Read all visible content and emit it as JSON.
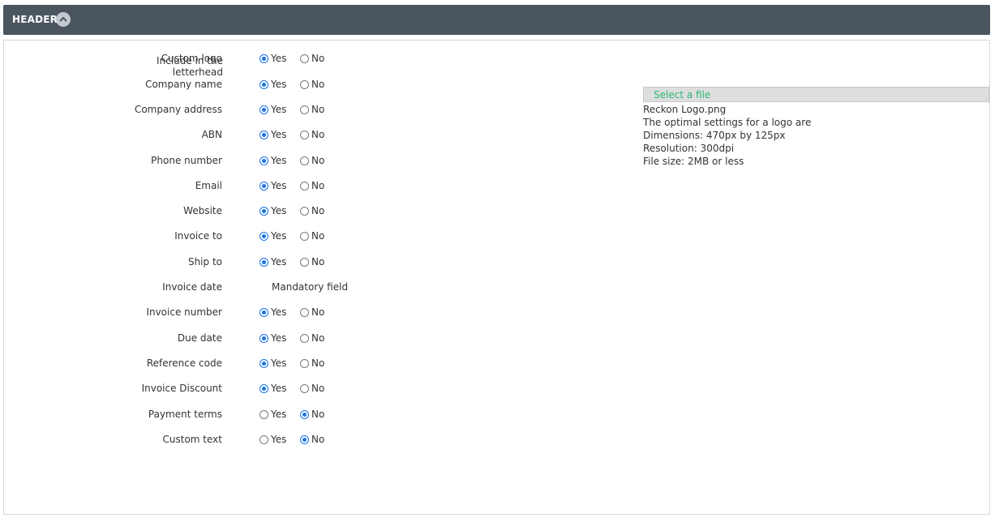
{
  "header": {
    "title": "HEADER"
  },
  "section": {
    "label": "Include in the letterhead"
  },
  "options": {
    "yes": "Yes",
    "no": "No"
  },
  "rows": [
    {
      "label": "Custom logo",
      "value": "Yes"
    },
    {
      "label": "Company name",
      "value": "Yes"
    },
    {
      "label": "Company address",
      "value": "Yes"
    },
    {
      "label": "ABN",
      "value": "Yes"
    },
    {
      "label": "Phone number",
      "value": "Yes"
    },
    {
      "label": "Email",
      "value": "Yes"
    },
    {
      "label": "Website",
      "value": "Yes"
    },
    {
      "label": "Invoice to",
      "value": "Yes"
    },
    {
      "label": "Ship to",
      "value": "Yes"
    },
    {
      "label": "Invoice date",
      "value": "Mandatory field",
      "mandatory": true
    },
    {
      "label": "Invoice number",
      "value": "Yes"
    },
    {
      "label": "Due date",
      "value": "Yes"
    },
    {
      "label": "Reference code",
      "value": "Yes"
    },
    {
      "label": "Invoice Discount",
      "value": "Yes"
    },
    {
      "label": "Payment terms",
      "value": "No"
    },
    {
      "label": "Custom text",
      "value": "No"
    }
  ],
  "file": {
    "select_label": "Select a file",
    "filename": "Reckon Logo.png",
    "hint_title": "The optimal settings for a logo are",
    "dimensions": "Dimensions: 470px by 125px",
    "resolution": "Resolution: 300dpi",
    "filesize": "File size: 2MB or less"
  },
  "colors": {
    "header_bg": "#4a5560",
    "radio_checked": "#1a73e8",
    "file_link": "#2bb673"
  },
  "icons": {
    "collapse": "chevron-up-icon"
  }
}
